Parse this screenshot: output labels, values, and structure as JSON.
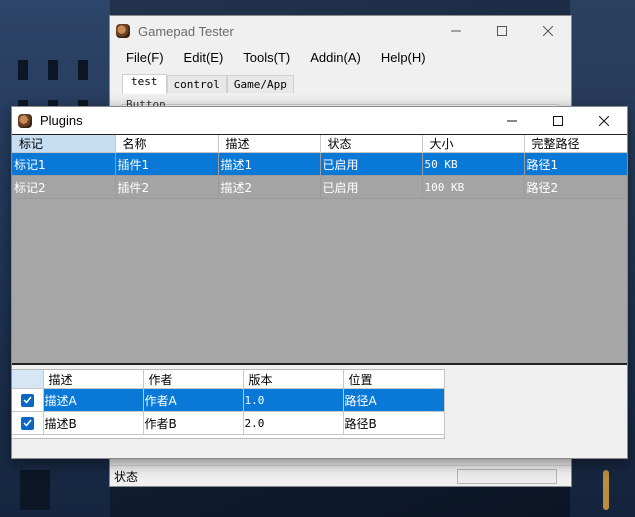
{
  "main_window": {
    "title": "Gamepad Tester",
    "menu": [
      "File(F)",
      "Edit(E)",
      "Tools(T)",
      "Addin(A)",
      "Help(H)"
    ],
    "tabs": [
      "test",
      "control",
      "Game/App"
    ],
    "tab_content_label": "Button",
    "status_text": "状态"
  },
  "plugins_dialog": {
    "title": "Plugins",
    "columns": [
      "标记",
      "名称",
      "描述",
      "状态",
      "大小",
      "完整路径"
    ],
    "rows": [
      [
        "标记1",
        "插件1",
        "描述1",
        "已启用",
        "50 KB",
        "路径1"
      ],
      [
        "标记2",
        "插件2",
        "描述2",
        "已启用",
        "100 KB",
        "路径2"
      ]
    ],
    "detail_columns": [
      "描述",
      "作者",
      "版本",
      "位置"
    ],
    "detail_rows": [
      {
        "checked": true,
        "cells": [
          "描述A",
          "作者A",
          "1.0",
          "路径A"
        ]
      },
      {
        "checked": true,
        "cells": [
          "描述B",
          "作者B",
          "2.0",
          "路径B"
        ]
      }
    ]
  },
  "colors": {
    "selection": "#0a78d7",
    "grid_background": "#a6a6a6",
    "header_highlight": "#c6ddf2"
  }
}
